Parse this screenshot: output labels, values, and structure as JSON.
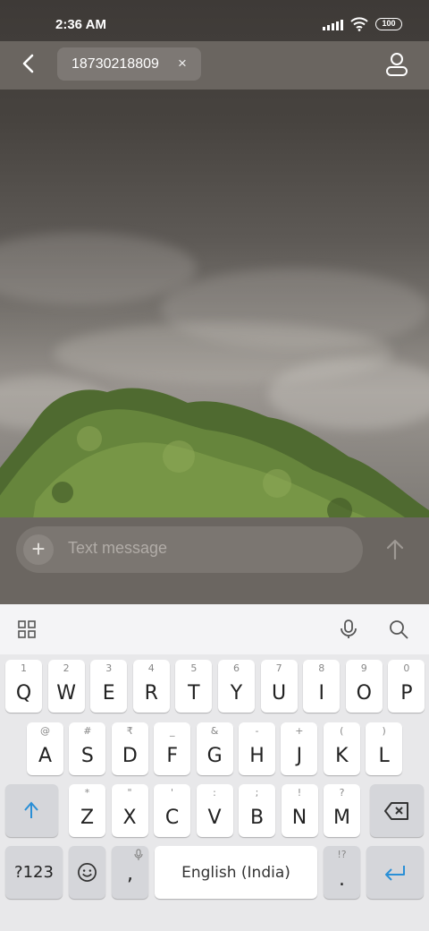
{
  "status_bar": {
    "time": "2:36 AM",
    "battery": "100",
    "icons": [
      "signal-icon",
      "wifi-icon",
      "battery-icon"
    ]
  },
  "header": {
    "recipient": "18730218809",
    "icons": [
      "back-arrow-icon",
      "close-icon",
      "person-icon"
    ]
  },
  "compose": {
    "placeholder": "Text message",
    "icons": [
      "plus-icon",
      "send-arrow-icon"
    ]
  },
  "keyboard": {
    "toolbar_icons": [
      "grid-icon",
      "microphone-icon",
      "search-icon"
    ],
    "row1": [
      {
        "main": "Q",
        "alt": "1"
      },
      {
        "main": "W",
        "alt": "2"
      },
      {
        "main": "E",
        "alt": "3"
      },
      {
        "main": "R",
        "alt": "4"
      },
      {
        "main": "T",
        "alt": "5"
      },
      {
        "main": "Y",
        "alt": "6"
      },
      {
        "main": "U",
        "alt": "7"
      },
      {
        "main": "I",
        "alt": "8"
      },
      {
        "main": "O",
        "alt": "9"
      },
      {
        "main": "P",
        "alt": "0"
      }
    ],
    "row2": [
      {
        "main": "A",
        "alt": "@"
      },
      {
        "main": "S",
        "alt": "#"
      },
      {
        "main": "D",
        "alt": "₹"
      },
      {
        "main": "F",
        "alt": "_"
      },
      {
        "main": "G",
        "alt": "&"
      },
      {
        "main": "H",
        "alt": "-"
      },
      {
        "main": "J",
        "alt": "+"
      },
      {
        "main": "K",
        "alt": "("
      },
      {
        "main": "L",
        "alt": ")"
      }
    ],
    "row3": [
      {
        "main": "Z",
        "alt": "*"
      },
      {
        "main": "X",
        "alt": "\""
      },
      {
        "main": "C",
        "alt": "'"
      },
      {
        "main": "V",
        "alt": ":"
      },
      {
        "main": "B",
        "alt": ";"
      },
      {
        "main": "N",
        "alt": "!"
      },
      {
        "main": "M",
        "alt": "?"
      }
    ],
    "symbols_key": "?123",
    "comma_key": ",",
    "space_key": "English (India)",
    "period_key": ".",
    "period_alt": "!?",
    "accent_color": "#2a8fd6"
  }
}
